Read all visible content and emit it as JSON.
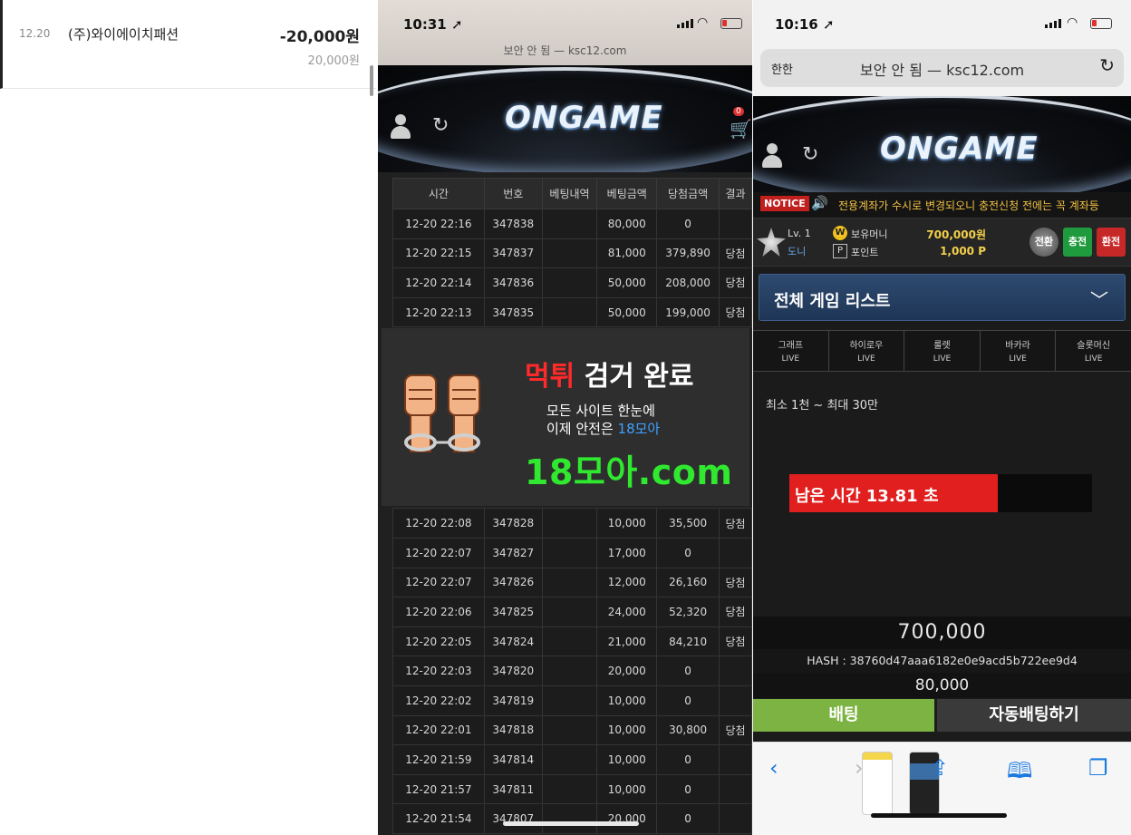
{
  "bank": {
    "date": "12.20",
    "merchant": "(주)와이에이치패션",
    "amount": "-20,000원",
    "balance": "20,000원"
  },
  "history_phone": {
    "time": "10:31 ➚",
    "url": "보안 안 됨 — ksc12.com",
    "logo": "ONGAME",
    "cart_count": "0",
    "table": {
      "headers": [
        "시간",
        "번호",
        "베팅내역",
        "베팅금액",
        "당첨금액",
        "결과"
      ],
      "rows_top": [
        [
          "12-20 22:16",
          "347838",
          "",
          "80,000",
          "0",
          ""
        ],
        [
          "12-20 22:15",
          "347837",
          "",
          "81,000",
          "379,890",
          "당첨"
        ],
        [
          "12-20 22:14",
          "347836",
          "",
          "50,000",
          "208,000",
          "당첨"
        ],
        [
          "12-20 22:13",
          "347835",
          "",
          "50,000",
          "199,000",
          "당첨"
        ]
      ],
      "rows_bottom": [
        [
          "12-20 22:08",
          "347828",
          "",
          "10,000",
          "35,500",
          "당첨"
        ],
        [
          "12-20 22:07",
          "347827",
          "",
          "17,000",
          "0",
          ""
        ],
        [
          "12-20 22:07",
          "347826",
          "",
          "12,000",
          "26,160",
          "당첨"
        ],
        [
          "12-20 22:06",
          "347825",
          "",
          "24,000",
          "52,320",
          "당첨"
        ],
        [
          "12-20 22:05",
          "347824",
          "",
          "21,000",
          "84,210",
          "당첨"
        ],
        [
          "12-20 22:03",
          "347820",
          "",
          "20,000",
          "0",
          ""
        ],
        [
          "12-20 22:02",
          "347819",
          "",
          "10,000",
          "0",
          ""
        ],
        [
          "12-20 22:01",
          "347818",
          "",
          "10,000",
          "30,800",
          "당첨"
        ],
        [
          "12-20 21:59",
          "347814",
          "",
          "10,000",
          "0",
          ""
        ],
        [
          "12-20 21:57",
          "347811",
          "",
          "10,000",
          "0",
          ""
        ],
        [
          "12-20 21:54",
          "347807",
          "",
          "20,000",
          "0",
          ""
        ]
      ]
    }
  },
  "ad": {
    "headline_red": "먹튀",
    "headline_rest": " 검거 완료",
    "sub1": "모든 사이트 한눈에",
    "sub2_prefix": "이제 안전은 ",
    "sub2_blue": "18모아",
    "domain": "18모아.com"
  },
  "game_phone": {
    "time": "10:16 ➚",
    "aa": "한한",
    "url": "보안 안 됨 — ksc12.com",
    "logo": "ONGAME",
    "notice_tag": "NOTICE",
    "notice_text": "전용계좌가 수시로 변경되오니 충전신청 전에는 꼭 계좌등",
    "level": "Lv. 1",
    "nickname": "도니",
    "money_label": "보유머니",
    "point_label": "포인트",
    "money_value": "700,000원",
    "point_value": "1,000 P",
    "btn_grey": "전환",
    "btn_charge": "충전",
    "btn_exchange": "환전",
    "game_list": "전체 게임 리스트",
    "tabs": [
      {
        "name": "그래프",
        "sub": "LIVE"
      },
      {
        "name": "하이로우",
        "sub": "LIVE"
      },
      {
        "name": "룰렛",
        "sub": "LIVE"
      },
      {
        "name": "바카라",
        "sub": "LIVE"
      },
      {
        "name": "슬롯머신",
        "sub": "LIVE"
      }
    ],
    "limit": "최소 1천 ~ 최대 30만",
    "timer_text": "남은 시간 13.81 초",
    "timer_progress": 0.69,
    "balance": "700,000",
    "hash": "HASH : 38760d47aaa6182e0e9acd5b722ee9d4",
    "bet_amount": "80,000",
    "bet_button": "배팅",
    "auto_bet_button": "자동배팅하기"
  },
  "colors": {
    "accent_red": "#e11f1f",
    "win_green": "#2fe82f",
    "bet_green": "#7cb342",
    "notice_yellow": "#f0c040"
  }
}
